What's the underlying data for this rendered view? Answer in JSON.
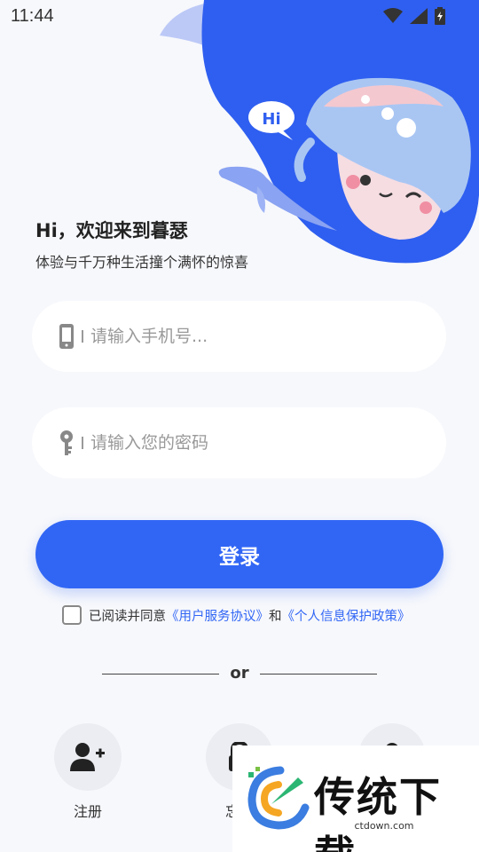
{
  "status_bar": {
    "time": "11:44"
  },
  "hero": {
    "bubble_text": "Hi"
  },
  "greeting": {
    "title": "Hi，欢迎来到暮瑟",
    "subtitle": "体验与千万种生活撞个满怀的惊喜"
  },
  "form": {
    "phone_placeholder": "请输入手机号...",
    "password_placeholder": "请输入您的密码",
    "login_label": "登录"
  },
  "agreement": {
    "prefix": "已阅读并同意",
    "user_agreement": "《用户服务协议》",
    "conjunction": "和",
    "privacy_policy": "《个人信息保护政策》"
  },
  "divider": {
    "text": "or"
  },
  "actions": [
    {
      "label": "注册",
      "icon": "add-user-icon"
    },
    {
      "label": "忘记",
      "icon": "lock-icon"
    },
    {
      "label": "",
      "icon": "user-icon"
    }
  ],
  "watermark": {
    "title": "传统下载",
    "url": "ctdown.com"
  },
  "colors": {
    "primary": "#3166f5",
    "hero_dark": "#2f5ff0",
    "hero_light": "#bcc9f7"
  }
}
